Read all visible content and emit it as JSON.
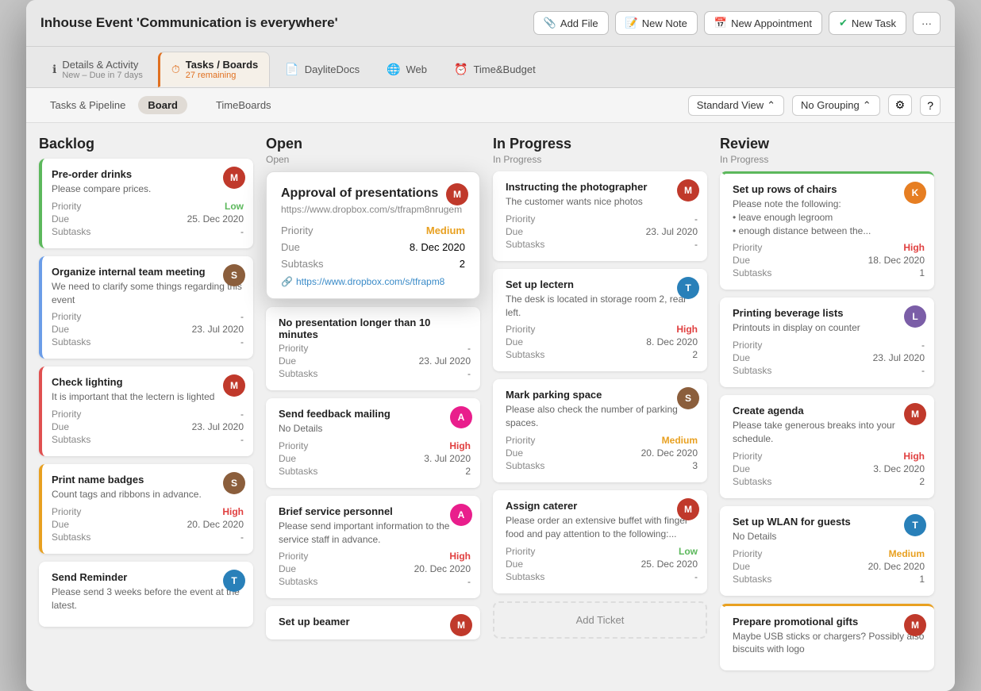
{
  "window": {
    "title": "Inhouse Event 'Communication is everywhere'"
  },
  "toolbar_buttons": {
    "add_file": "Add File",
    "new_note": "New Note",
    "new_appointment": "New Appointment",
    "new_task": "New Task",
    "more": "···"
  },
  "tabs": [
    {
      "id": "details",
      "icon": "ℹ",
      "label": "Details & Activity",
      "sublabel": "New – Due in 7 days",
      "active": false
    },
    {
      "id": "tasks",
      "icon": "⏱",
      "label": "Tasks / Boards",
      "sublabel": "27 remaining",
      "active": true
    },
    {
      "id": "daylite",
      "icon": "📄",
      "label": "DayliteDocs",
      "sublabel": "",
      "active": false
    },
    {
      "id": "web",
      "icon": "🌐",
      "label": "Web",
      "sublabel": "",
      "active": false
    },
    {
      "id": "time",
      "icon": "⏰",
      "label": "Time&Budget",
      "sublabel": "",
      "active": false
    }
  ],
  "view_tabs": {
    "tasks_pipeline": "Tasks & Pipeline",
    "board": "Board",
    "timeboards": "TimeBoards",
    "standard_view": "Standard View",
    "no_grouping": "No Grouping"
  },
  "columns": [
    {
      "id": "backlog",
      "title": "Backlog",
      "subtitle": "",
      "cards": [
        {
          "title": "Pre-order drinks",
          "desc": "Please compare prices.",
          "priority": "Low",
          "priority_class": "priority-low",
          "due": "25. Dec 2020",
          "subtasks": "-",
          "avatar_class": "avatar-red",
          "avatar_text": "M",
          "border": "green-left"
        },
        {
          "title": "Organize internal team meeting",
          "desc": "We need to clarify some things regarding this event",
          "priority": "-",
          "priority_class": "",
          "due": "23. Jul 2020",
          "subtasks": "-",
          "avatar_class": "avatar-brown",
          "avatar_text": "S",
          "border": "blue-left"
        },
        {
          "title": "Check lighting",
          "desc": "It is important that the lectern is lighted",
          "priority": "-",
          "priority_class": "",
          "due": "23. Jul 2020",
          "subtasks": "-",
          "avatar_class": "avatar-red",
          "avatar_text": "M",
          "border": "red-left"
        },
        {
          "title": "Print name badges",
          "desc": "Count tags and ribbons in advance.",
          "priority": "High",
          "priority_class": "priority-high",
          "due": "20. Dec 2020",
          "subtasks": "-",
          "avatar_class": "avatar-brown",
          "avatar_text": "S",
          "border": "orange-left"
        },
        {
          "title": "Send Reminder",
          "desc": "Please send 3 weeks before the event at the latest.",
          "priority": "",
          "priority_class": "",
          "due": "",
          "subtasks": "",
          "avatar_class": "avatar-blue",
          "avatar_text": "T",
          "border": ""
        }
      ]
    },
    {
      "id": "open",
      "title": "Open",
      "subtitle": "Open",
      "cards": [
        {
          "id": "popup",
          "title": "Approval of presentations",
          "url": "https://www.dropbox.com/s/tfrapm8nrugem",
          "priority": "Medium",
          "priority_class": "priority-medium",
          "due": "8. Dec 2020",
          "subtasks": "2",
          "link": "https://www.dropbox.com/s/tfrapm8",
          "avatar_class": "avatar-red",
          "avatar_text": "M"
        },
        {
          "title": "No presentation longer than 10 minutes",
          "desc": "",
          "priority": "-",
          "priority_class": "",
          "due": "23. Jul 2020",
          "subtasks": "-",
          "avatar_class": "",
          "avatar_text": "",
          "border": ""
        },
        {
          "title": "Send feedback mailing",
          "desc": "No Details",
          "priority": "High",
          "priority_class": "priority-high",
          "due": "3. Jul 2020",
          "subtasks": "2",
          "avatar_class": "avatar-pink",
          "avatar_text": "A",
          "border": ""
        },
        {
          "title": "Brief service personnel",
          "desc": "Please send important information to the service staff in advance.",
          "priority": "High",
          "priority_class": "priority-high",
          "due": "20. Dec 2020",
          "subtasks": "-",
          "avatar_class": "avatar-pink",
          "avatar_text": "A",
          "border": ""
        },
        {
          "title": "Set up beamer",
          "desc": "",
          "priority": "",
          "priority_class": "",
          "due": "",
          "subtasks": "",
          "avatar_class": "avatar-red",
          "avatar_text": "M",
          "border": ""
        }
      ]
    },
    {
      "id": "in-progress",
      "title": "In Progress",
      "subtitle": "In Progress",
      "cards": [
        {
          "title": "Instructing the photographer",
          "desc": "The customer wants nice photos",
          "priority": "-",
          "priority_class": "",
          "due": "23. Jul 2020",
          "subtasks": "-",
          "avatar_class": "avatar-red",
          "avatar_text": "M",
          "border": ""
        },
        {
          "title": "Set up lectern",
          "desc": "The desk is located in storage room 2, rear left.",
          "priority": "High",
          "priority_class": "priority-high",
          "due": "8. Dec 2020",
          "subtasks": "2",
          "avatar_class": "avatar-blue",
          "avatar_text": "T",
          "border": ""
        },
        {
          "title": "Mark parking space",
          "desc": "Please also check the number of parking spaces.",
          "priority": "Medium",
          "priority_class": "priority-medium",
          "due": "20. Dec 2020",
          "subtasks": "3",
          "avatar_class": "avatar-brown",
          "avatar_text": "S",
          "border": ""
        },
        {
          "title": "Assign caterer",
          "desc": "Please order an extensive buffet with finger food and pay attention to the following:...",
          "priority": "Low",
          "priority_class": "priority-low",
          "due": "25. Dec 2020",
          "subtasks": "-",
          "avatar_class": "avatar-red",
          "avatar_text": "M",
          "border": ""
        }
      ],
      "add_ticket": "Add Ticket"
    },
    {
      "id": "review",
      "title": "Review",
      "subtitle": "In Progress",
      "cards": [
        {
          "title": "Set up rows of chairs",
          "desc": "Please note the following:\n• leave enough legroom\n• enough distance between the...",
          "priority": "High",
          "priority_class": "priority-high",
          "due": "18. Dec 2020",
          "subtasks": "1",
          "avatar_class": "avatar-orange",
          "avatar_text": "K",
          "border": ""
        },
        {
          "title": "Printing beverage lists",
          "desc": "Printouts in display on counter",
          "priority": "-",
          "priority_class": "",
          "due": "23. Jul 2020",
          "subtasks": "-",
          "avatar_class": "avatar-purple",
          "avatar_text": "L",
          "border": ""
        },
        {
          "title": "Create agenda",
          "desc": "Please take generous breaks into your schedule.",
          "priority": "High",
          "priority_class": "priority-high",
          "due": "3. Dec 2020",
          "subtasks": "2",
          "avatar_class": "avatar-red",
          "avatar_text": "M",
          "border": ""
        },
        {
          "title": "Set up WLAN for guests",
          "desc": "No Details",
          "priority": "Medium",
          "priority_class": "priority-medium",
          "due": "20. Dec 2020",
          "subtasks": "1",
          "avatar_class": "avatar-blue",
          "avatar_text": "T",
          "border": ""
        },
        {
          "title": "Prepare promotional gifts",
          "desc": "Maybe USB sticks or chargers? Possibly also biscuits with logo",
          "priority": "",
          "priority_class": "",
          "due": "",
          "subtasks": "",
          "avatar_class": "avatar-red",
          "avatar_text": "M",
          "border": ""
        }
      ]
    }
  ],
  "popup": {
    "title": "Approval of presentations",
    "url": "https://www.dropbox.com/s/tfrapm8nrugem",
    "priority_label": "Priority",
    "priority_value": "Medium",
    "due_label": "Due",
    "due_value": "8. Dec 2020",
    "subtasks_label": "Subtasks",
    "subtasks_value": "2",
    "link_text": "https://www.dropbox.com/s/tfrapm8",
    "avatar_text": "M"
  }
}
